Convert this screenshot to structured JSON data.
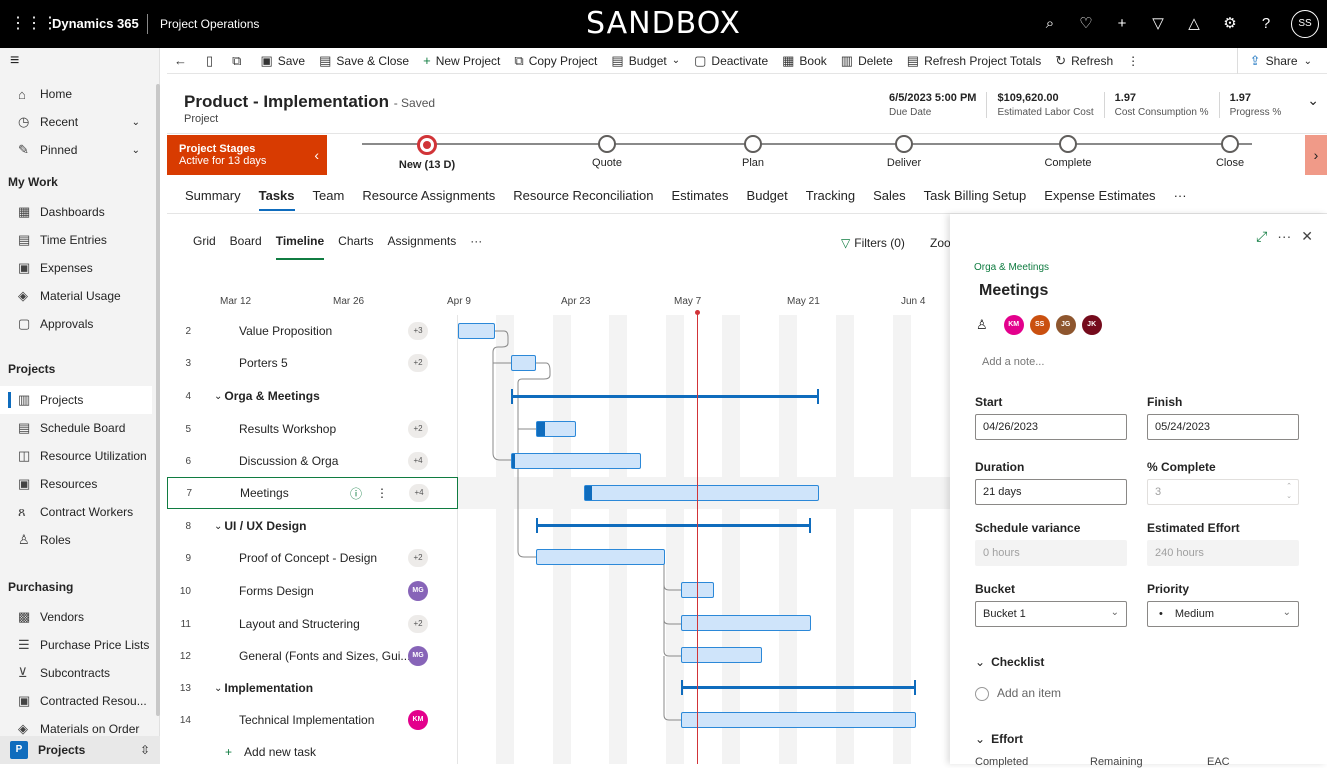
{
  "topbar": {
    "brand": "Dynamics 365",
    "app": "Project Operations",
    "env": "SANDBOX",
    "avatar": "SS"
  },
  "sidebar": {
    "items": [
      {
        "label": "Home"
      },
      {
        "label": "Recent"
      },
      {
        "label": "Pinned"
      }
    ],
    "sections": [
      "My Work",
      "Projects",
      "Purchasing"
    ],
    "mywork": [
      "Dashboards",
      "Time Entries",
      "Expenses",
      "Material Usage",
      "Approvals"
    ],
    "projects": [
      "Projects",
      "Schedule Board",
      "Resource Utilization",
      "Resources",
      "Contract Workers",
      "Roles"
    ],
    "purchasing": [
      "Vendors",
      "Purchase Price Lists",
      "Subcontracts",
      "Contracted Resou...",
      "Materials on Order"
    ],
    "footer_badge": "P",
    "footer_label": "Projects"
  },
  "cmdbar": {
    "items": [
      "Save",
      "Save & Close",
      "New Project",
      "Copy Project",
      "Budget",
      "Deactivate",
      "Book",
      "Delete",
      "Refresh Project Totals",
      "Refresh"
    ],
    "share": "Share"
  },
  "header": {
    "title": "Product - Implementation",
    "saved": "- Saved",
    "subtitle": "Project",
    "fields": [
      {
        "value": "6/5/2023 5:00 PM",
        "label": "Due Date"
      },
      {
        "value": "$109,620.00",
        "label": "Estimated Labor Cost"
      },
      {
        "value": "1.97",
        "label": "Cost Consumption %"
      },
      {
        "value": "1.97",
        "label": "Progress %"
      }
    ]
  },
  "stages": {
    "box_title": "Project Stages",
    "box_sub": "Active for 13 days",
    "list": [
      "New (13 D)",
      "Quote",
      "Plan",
      "Deliver",
      "Complete",
      "Close"
    ]
  },
  "tabs": [
    "Summary",
    "Tasks",
    "Team",
    "Resource Assignments",
    "Resource Reconciliation",
    "Estimates",
    "Budget",
    "Tracking",
    "Sales",
    "Task Billing Setup",
    "Expense Estimates",
    "···"
  ],
  "subtabs": [
    "Grid",
    "Board",
    "Timeline",
    "Charts",
    "Assignments",
    "···"
  ],
  "filters": "Filters (0)",
  "zoom": "Zoo",
  "dates": [
    "Mar 12",
    "Mar 26",
    "Apr 9",
    "Apr 23",
    "May 7",
    "May 21",
    "Jun 4"
  ],
  "tasks": [
    {
      "num": "2",
      "name": "Value Proposition",
      "badge": "+3"
    },
    {
      "num": "3",
      "name": "Porters 5",
      "badge": "+2"
    },
    {
      "num": "4",
      "name": "Orga & Meetings",
      "group": true
    },
    {
      "num": "5",
      "name": "Results Workshop",
      "badge": "+2"
    },
    {
      "num": "6",
      "name": "Discussion & Orga",
      "badge": "+4"
    },
    {
      "num": "7",
      "name": "Meetings",
      "badge": "+4"
    },
    {
      "num": "8",
      "name": "UI / UX Design",
      "group": true
    },
    {
      "num": "9",
      "name": "Proof of Concept - Design",
      "badge": "+2"
    },
    {
      "num": "10",
      "name": "Forms Design",
      "avatar": "MG"
    },
    {
      "num": "11",
      "name": "Layout and Structering",
      "badge": "+2"
    },
    {
      "num": "12",
      "name": "General (Fonts and Sizes, Gui...",
      "avatar": "MG"
    },
    {
      "num": "13",
      "name": "Implementation",
      "group": true
    },
    {
      "num": "14",
      "name": "Technical Implementation",
      "avatar": "KM"
    }
  ],
  "add_task": "Add new task",
  "panel": {
    "breadcrumb": "Orga & Meetings",
    "title": "Meetings",
    "assignees": [
      "KM",
      "SS",
      "JG",
      "JK"
    ],
    "note_placeholder": "Add a note...",
    "start_label": "Start",
    "start": "04/26/2023",
    "finish_label": "Finish",
    "finish": "05/24/2023",
    "duration_label": "Duration",
    "duration": "21 days",
    "complete_label": "% Complete",
    "complete": "3",
    "variance_label": "Schedule variance",
    "variance": "0 hours",
    "effort_label": "Estimated Effort",
    "effort": "240 hours",
    "bucket_label": "Bucket",
    "bucket": "Bucket 1",
    "priority_label": "Priority",
    "priority": "Medium",
    "checklist": "Checklist",
    "add_item": "Add an item",
    "effort_section": "Effort",
    "cut": [
      "Completed",
      "Remaining",
      "EAC"
    ]
  },
  "colors": {
    "accent": "#0f6cbd",
    "stage": "#d83b01",
    "green": "#107c41",
    "km": "#e3008c",
    "ss": "#ca5010",
    "jg": "#8e562e",
    "jk": "#750b1c",
    "mg": "#8764b8"
  }
}
